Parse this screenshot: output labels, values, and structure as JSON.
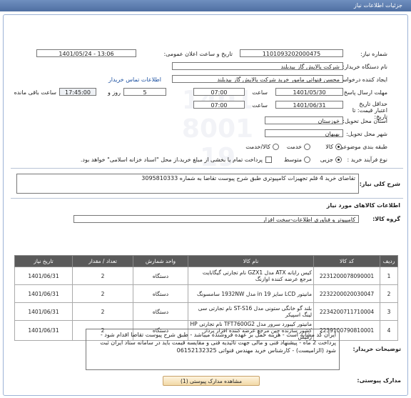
{
  "header": {
    "title": "جزئیات اطلاعات نیاز"
  },
  "fields": {
    "need_number_label": "شماره نیاز:",
    "need_number": "1101093202000475",
    "announce_label": "تاریخ و ساعت اعلان عمومی:",
    "announce_value": "1401/05/24 - 13:06",
    "buyer_label": "نام دستگاه خریدار:",
    "buyer_value": "شرکت پالایش گاز بیدبلند",
    "requester_label": "ایجاد کننده درخواست:",
    "requester_value": "محسن قنواتی مامور خرید شرکت پالایش گاز بیدبلند",
    "contact_link": "اطلاعات تماس خریدار",
    "deadline_label": "مهلت ارسال پاسخ: تا تاریخ:",
    "deadline_date": "1401/05/30",
    "time_label": "ساعت",
    "deadline_time": "07:00",
    "days_value": "5",
    "days_label": "روز و",
    "remaining_time": "17:45:00",
    "remaining_label": "ساعت باقی مانده",
    "validity_label": "حداقل تاریخ اعتبار قیمت: تا تاریخ:",
    "validity_date": "1401/06/31",
    "validity_time": "07:00",
    "province_label": "استان محل تحویل:",
    "province_value": "خوزستان",
    "city_label": "شهر محل تحویل:",
    "city_value": "بهبهان",
    "category_label": "طبقه بندی موضوعی:",
    "category_options": [
      "کالا",
      "خدمت",
      "کالا/خدمت"
    ],
    "category_selected": "کالا",
    "process_label": "نوع فرآیند خرید :",
    "process_options": [
      "جزیی",
      "متوسط"
    ],
    "process_selected": "جزیی",
    "payment_note": "پرداخت تمام یا بخشی از مبلغ خرید،از محل \"اسناد خزانه اسلامی\" خواهد بود."
  },
  "summary": {
    "label": "شرح کلی نیاز:",
    "value": "تقاضای خرید 4 قلم تجهیزات کامپیوتری طبق شرح پیوست تقاضا به شماره 3095810333"
  },
  "goods": {
    "section_title": "اطلاعات کالاهای مورد نیاز",
    "group_label": "گروه کالا:",
    "group_value": "کامپیوتر و فناوری اطلاعات-سخت افزار",
    "columns": [
      "ردیف",
      "کد کالا",
      "نام کالا",
      "واحد شمارش",
      "تعداد / مقدار",
      "تاریخ نیاز"
    ],
    "rows": [
      {
        "row": "1",
        "code": "2231200078090001",
        "name": "کیس رایانه ATX مدل GZX1 نام تجارتی گیگابایت مرجع عرضه کننده اوازنگ",
        "unit": "دستگاه",
        "qty": "2",
        "date": "1401/06/31"
      },
      {
        "row": "2",
        "code": "2232200020030047",
        "name": "مانیتور LCD سایز 19 in مدل 1932NW سامسونگ",
        "unit": "دستگاه",
        "qty": "2",
        "date": "1401/06/31"
      },
      {
        "row": "3",
        "code": "2234200711710004",
        "name": "بلند گو خانگی ستونی مدل ST-S16 نام تجارتی سی لینگ اسپیکر",
        "unit": "دستگاه",
        "qty": "2",
        "date": "1401/06/31"
      },
      {
        "row": "4",
        "code": "2239100790810001",
        "name": "مانیتور کیبورد سرور مدل TFT7600G2 نام تجارتی HP کشور سازنده چین مرجع عرضه کننده افزار پرداز رمیس",
        "unit": "دستگاه",
        "qty": "2",
        "date": "1401/06/31"
      }
    ]
  },
  "buyer_notes": {
    "label": "توضیحات خریدار:",
    "text": "ایران کد مشابه است - هزینه حمل بر عهده فروشنده میباشد - طبق شرح پیوست تقاضا اقدام شود - پرداخت 2 ماه - پیشنهاد فنی و مالی جهت تائیدیه فنی و مقایسه قیمت باید در سامانه ستاد ایران ثبت شود (الزامیست) - کارشناس خرید  مهندس قنواتی 06152132325"
  },
  "attachments": {
    "label": "مدارک پیوستی:",
    "button": "مشاهده مدارک پیوستی (1)"
  }
}
